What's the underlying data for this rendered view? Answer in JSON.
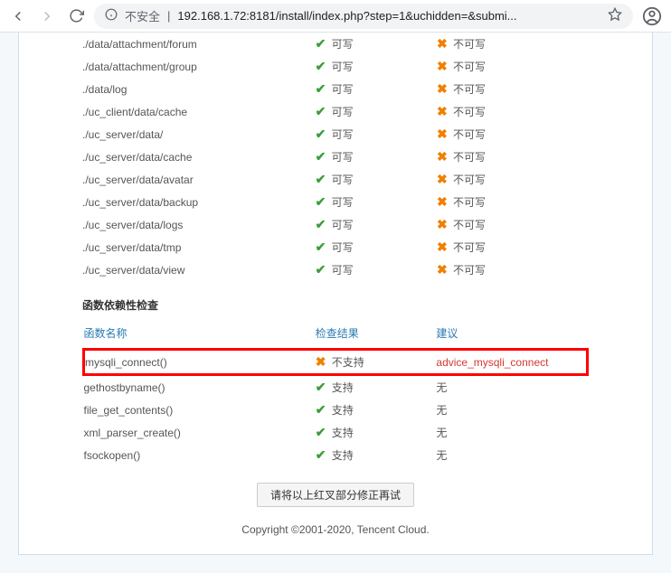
{
  "browser": {
    "warn_label": "不安全",
    "url": "192.168.1.72:8181/install/index.php?step=1&uchidden=&submi..."
  },
  "dir_check": {
    "rows": [
      {
        "path": "./data/attachment/forum",
        "status": "可写",
        "advice": "不可写"
      },
      {
        "path": "./data/attachment/group",
        "status": "可写",
        "advice": "不可写"
      },
      {
        "path": "./data/log",
        "status": "可写",
        "advice": "不可写"
      },
      {
        "path": "./uc_client/data/cache",
        "status": "可写",
        "advice": "不可写"
      },
      {
        "path": "./uc_server/data/",
        "status": "可写",
        "advice": "不可写"
      },
      {
        "path": "./uc_server/data/cache",
        "status": "可写",
        "advice": "不可写"
      },
      {
        "path": "./uc_server/data/avatar",
        "status": "可写",
        "advice": "不可写"
      },
      {
        "path": "./uc_server/data/backup",
        "status": "可写",
        "advice": "不可写"
      },
      {
        "path": "./uc_server/data/logs",
        "status": "可写",
        "advice": "不可写"
      },
      {
        "path": "./uc_server/data/tmp",
        "status": "可写",
        "advice": "不可写"
      },
      {
        "path": "./uc_server/data/view",
        "status": "可写",
        "advice": "不可写"
      }
    ]
  },
  "func_check": {
    "title": "函数依赖性检查",
    "headers": {
      "name": "函数名称",
      "check": "检查结果",
      "advice": "建议"
    },
    "rows": [
      {
        "name": "mysqli_connect()",
        "ok": false,
        "status": "不支持",
        "advice": "advice_mysqli_connect",
        "highlight": true
      },
      {
        "name": "gethostbyname()",
        "ok": true,
        "status": "支持",
        "advice": "无"
      },
      {
        "name": "file_get_contents()",
        "ok": true,
        "status": "支持",
        "advice": "无"
      },
      {
        "name": "xml_parser_create()",
        "ok": true,
        "status": "支持",
        "advice": "无"
      },
      {
        "name": "fsockopen()",
        "ok": true,
        "status": "支持",
        "advice": "无"
      }
    ]
  },
  "retry_button": "请将以上红叉部分修正再试",
  "footer": "Copyright ©2001-2020, Tencent Cloud."
}
